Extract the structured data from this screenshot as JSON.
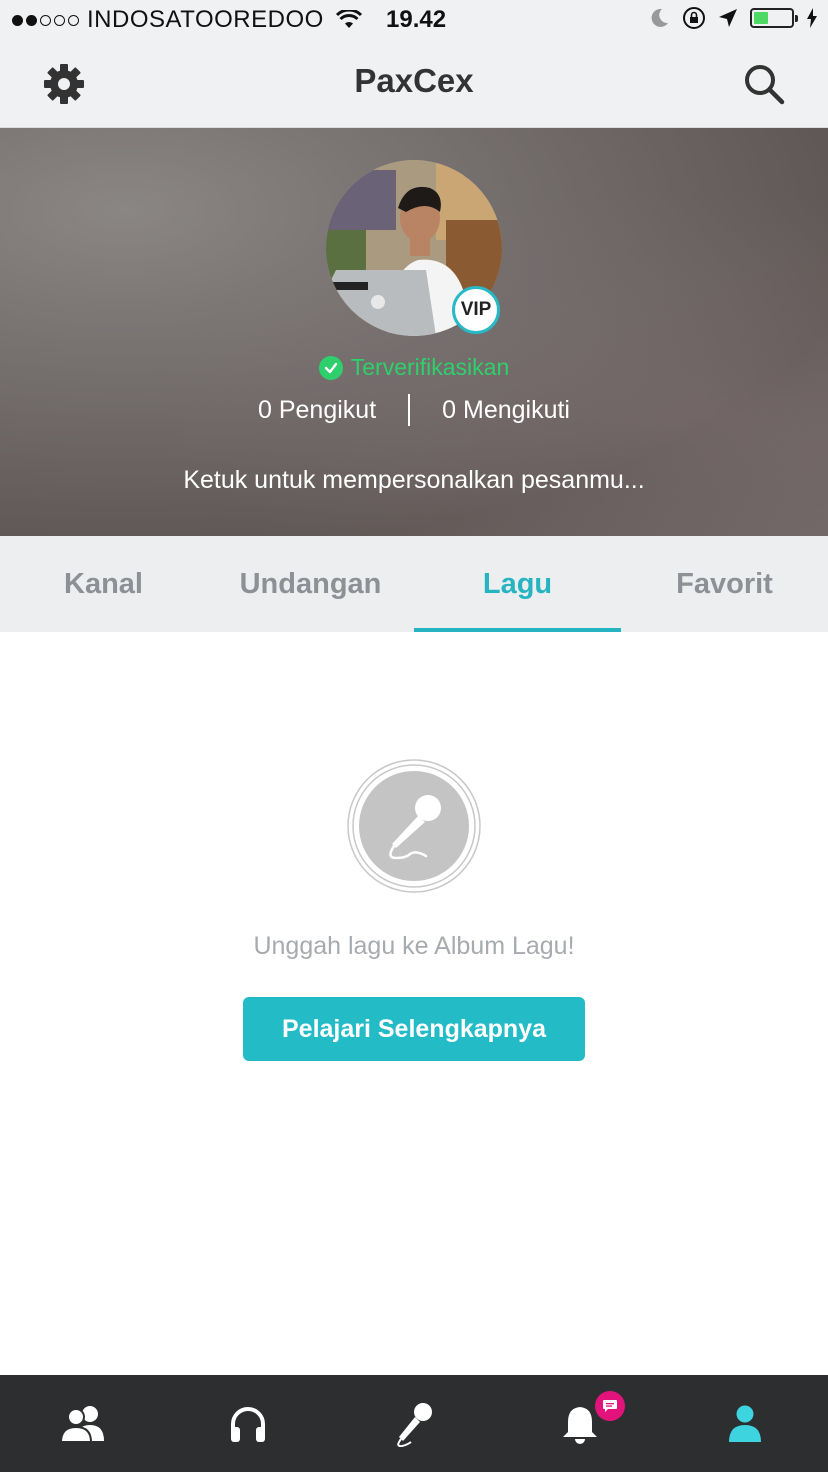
{
  "status_bar": {
    "carrier": "INDOSATOOREDOO",
    "time": "19.42",
    "signal_filled": 2,
    "signal_total": 5,
    "battery_level": 0.34
  },
  "nav": {
    "title": "PaxCex",
    "left_icon": "gear-icon",
    "right_icon": "search-icon"
  },
  "profile": {
    "vip_label": "VIP",
    "verified_label": "Terverifikasikan",
    "followers_label": "0 Pengikut",
    "following_label": "0 Mengikuti",
    "bio_placeholder": "Ketuk untuk mempersonalkan pesanmu..."
  },
  "tabs": [
    {
      "label": "Kanal",
      "active": false
    },
    {
      "label": "Undangan",
      "active": false
    },
    {
      "label": "Lagu",
      "active": true
    },
    {
      "label": "Favorit",
      "active": false
    }
  ],
  "empty_state": {
    "icon": "microphone-icon",
    "message": "Unggah lagu ke Album Lagu!",
    "button_label": "Pelajari Selengkapnya"
  },
  "bottom_bar": {
    "items": [
      "people-icon",
      "headphones-icon",
      "microphone-icon",
      "bell-icon",
      "profile-icon"
    ],
    "active_index": 4
  },
  "colors": {
    "accent": "#27b4c2",
    "verified": "#2ed06b",
    "badge": "#e2147c",
    "bottom_bar": "#2c2e30"
  }
}
